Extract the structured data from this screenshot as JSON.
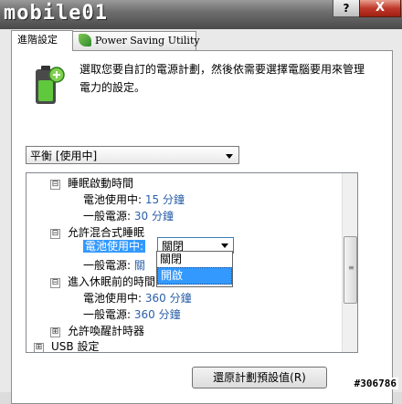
{
  "window": {
    "help_label": "?",
    "close_label": "X",
    "logo_text": "mobile01"
  },
  "tabs": [
    {
      "label": "進階設定",
      "active": true
    },
    {
      "label": "Power Saving Utility",
      "active": false
    }
  ],
  "intro_text": "選取您要自訂的電源計劃，然後依需要選擇電腦要用來管理電力的設定。",
  "plan_select": {
    "value": "平衡 [使用中]"
  },
  "tree": {
    "sleep_after": {
      "label": "睡眠啟動時間",
      "expander": "⊟"
    },
    "sleep_battery": {
      "label": "電池使用中:",
      "value": "15 分鐘"
    },
    "sleep_plugged": {
      "label": "一般電源:",
      "value": "30 分鐘"
    },
    "hybrid_sleep": {
      "label": "允許混合式睡眠",
      "expander": "⊟"
    },
    "hybrid_battery": {
      "label": "電池使用中:",
      "value": "關閉"
    },
    "hybrid_plugged": {
      "label": "一般電源:",
      "value": "關"
    },
    "hibernate_after": {
      "label": "進入休眠前的時間",
      "expander": "⊟"
    },
    "hibernate_battery": {
      "label": "電池使用中:",
      "value": "360 分鐘"
    },
    "hibernate_plugged": {
      "label": "一般電源:",
      "value": "360 分鐘"
    },
    "wake_timers": {
      "label": "允許喚醒計時器",
      "expander": "⊞"
    },
    "usb_settings": {
      "label": "USB 設定",
      "expander": "⊞"
    }
  },
  "dropdown_options": [
    "關閉",
    "開啟"
  ],
  "restore_button": "還原計劃預設值(R)",
  "watermark_id": "#306786",
  "colors": {
    "accent": "#3399ff",
    "value_text": "#2a5fa8"
  }
}
